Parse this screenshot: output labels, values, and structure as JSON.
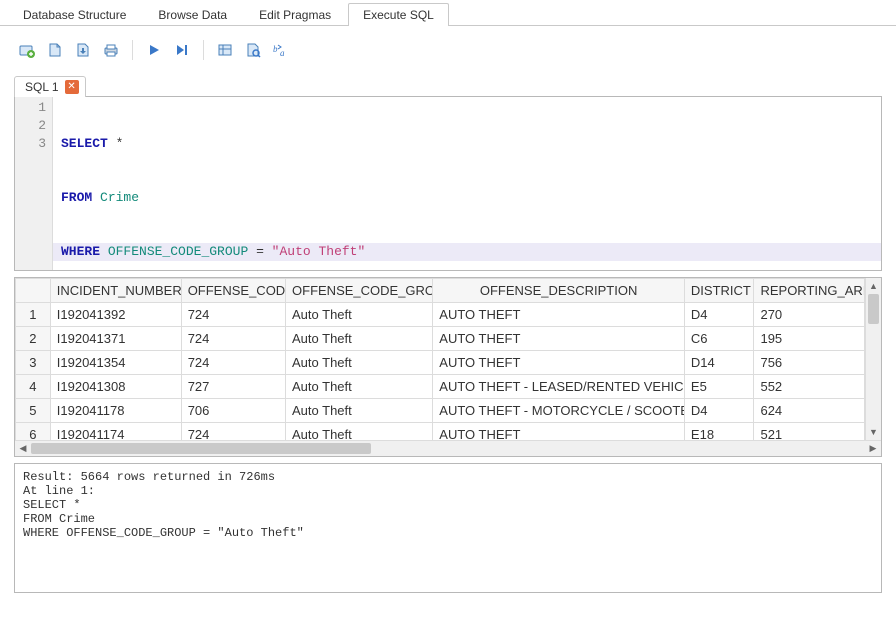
{
  "tabs": {
    "database_structure": "Database Structure",
    "browse_data": "Browse Data",
    "edit_pragmas": "Edit Pragmas",
    "execute_sql": "Execute SQL"
  },
  "sql_tab": {
    "label": "SQL 1"
  },
  "editor": {
    "line_numbers": [
      "1",
      "2",
      "3"
    ],
    "l1": {
      "kw": "SELECT",
      "rest": " *"
    },
    "l2": {
      "kw": "FROM",
      "ident": "Crime"
    },
    "l3": {
      "kw": "WHERE",
      "ident": "OFFENSE_CODE_GROUP",
      "op": " = ",
      "str": "\"Auto Theft\""
    }
  },
  "columns": {
    "incident": "INCIDENT_NUMBER",
    "code": "OFFENSE_CODE",
    "group": "OFFENSE_CODE_GROUP",
    "desc": "OFFENSE_DESCRIPTION",
    "district": "DISTRICT",
    "reporting": "REPORTING_ARI"
  },
  "rows": [
    {
      "n": "1",
      "incident": "I192041392",
      "code": "724",
      "group": "Auto Theft",
      "desc": "AUTO THEFT",
      "district": "D4",
      "rep": "270"
    },
    {
      "n": "2",
      "incident": "I192041371",
      "code": "724",
      "group": "Auto Theft",
      "desc": "AUTO THEFT",
      "district": "C6",
      "rep": "195"
    },
    {
      "n": "3",
      "incident": "I192041354",
      "code": "724",
      "group": "Auto Theft",
      "desc": "AUTO THEFT",
      "district": "D14",
      "rep": "756"
    },
    {
      "n": "4",
      "incident": "I192041308",
      "code": "727",
      "group": "Auto Theft",
      "desc": "AUTO THEFT - LEASED/RENTED VEHICLE",
      "district": "E5",
      "rep": "552"
    },
    {
      "n": "5",
      "incident": "I192041178",
      "code": "706",
      "group": "Auto Theft",
      "desc": "AUTO THEFT - MOTORCYCLE / SCOOTER",
      "district": "D4",
      "rep": "624"
    },
    {
      "n": "6",
      "incident": "I192041174",
      "code": "724",
      "group": "Auto Theft",
      "desc": "AUTO THEFT",
      "district": "E18",
      "rep": "521"
    }
  ],
  "status": "Result: 5664 rows returned in 726ms\nAt line 1:\nSELECT *\nFROM Crime\nWHERE OFFENSE_CODE_GROUP = \"Auto Theft\""
}
